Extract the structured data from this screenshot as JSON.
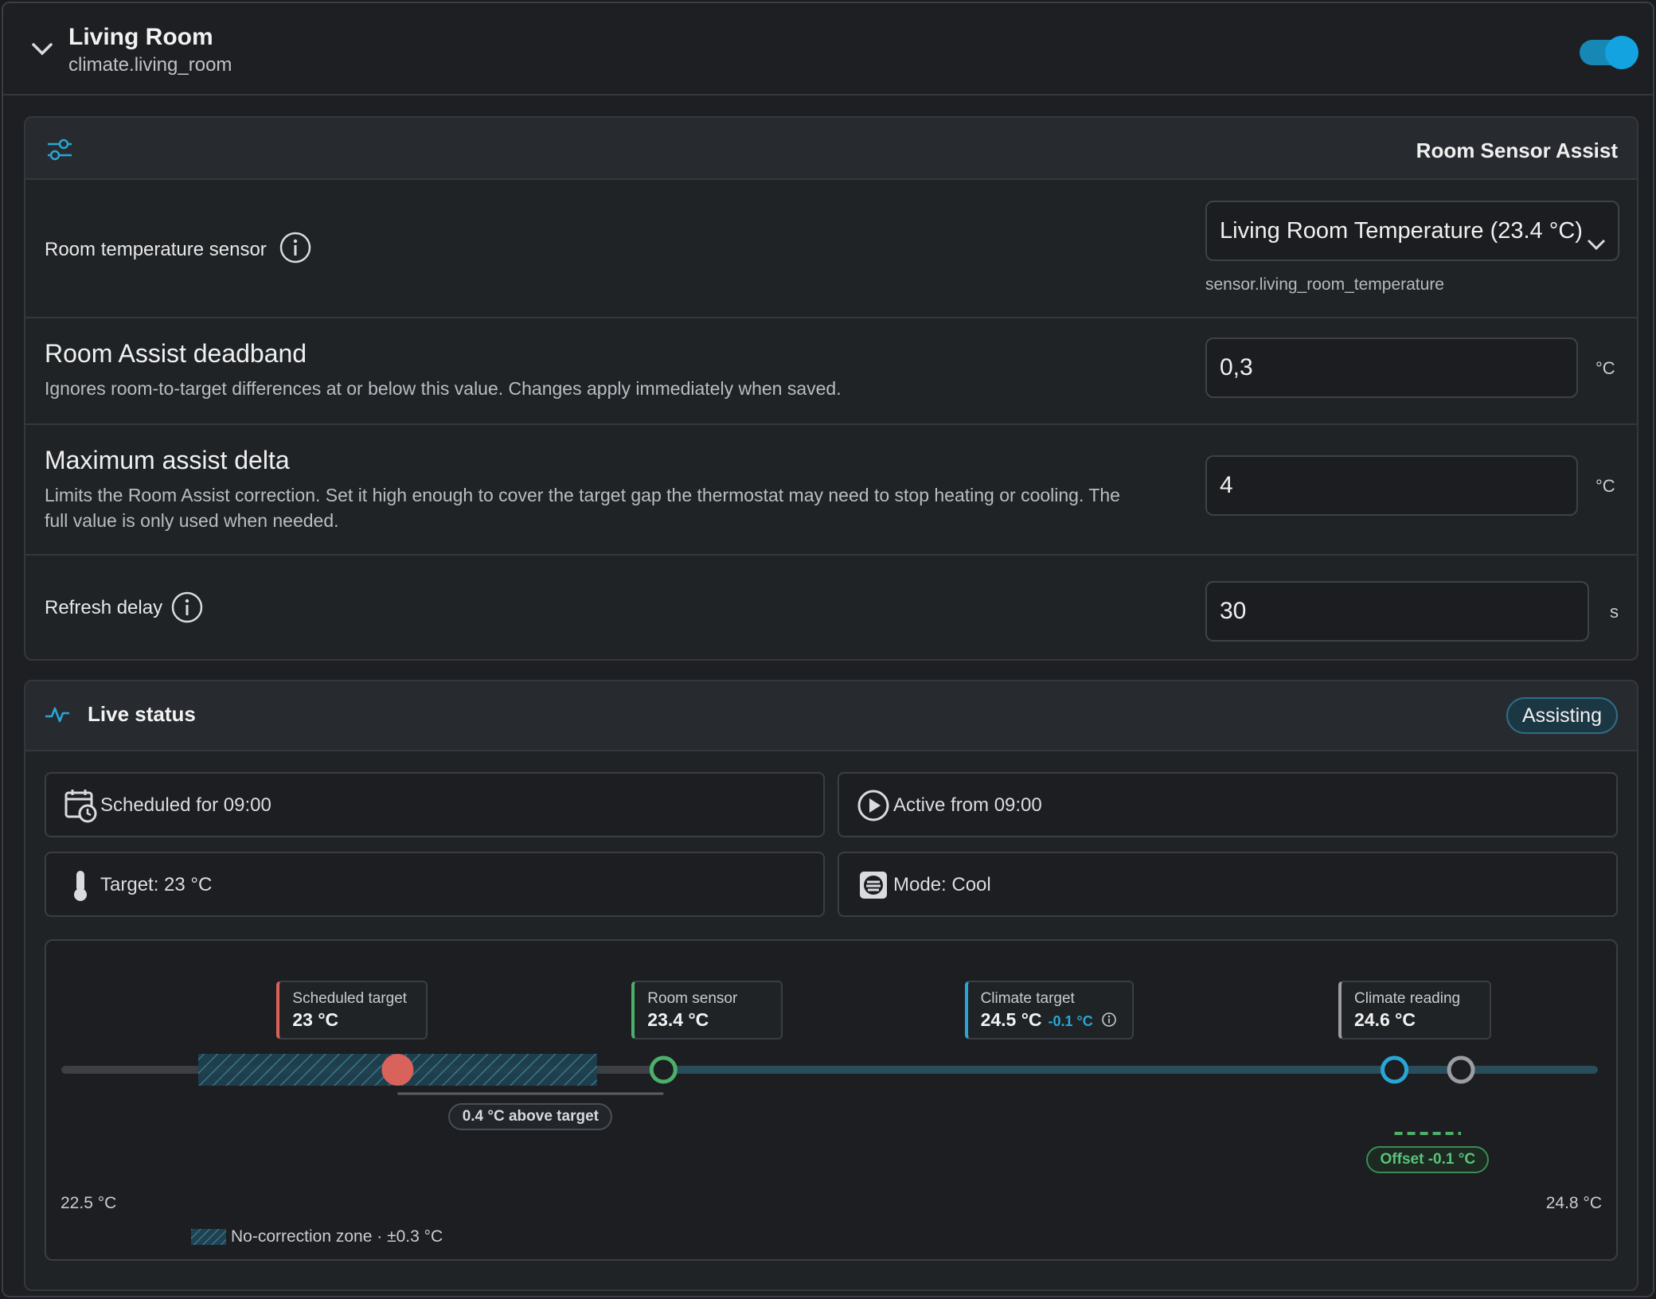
{
  "header": {
    "title": "Living Room",
    "entity_id": "climate.living_room",
    "enabled": true
  },
  "room_sensor_assist": {
    "title": "Room Sensor Assist",
    "sensor": {
      "label": "Room temperature sensor",
      "value": "Living Room Temperature (23.4 °C)",
      "helper": "sensor.living_room_temperature"
    },
    "deadband": {
      "label": "Room Assist deadband",
      "description": "Ignores room-to-target differences at or below this value. Changes apply immediately when saved.",
      "value": "0,3",
      "unit": "°C"
    },
    "max_delta": {
      "label": "Maximum assist delta",
      "description_line1": "Limits the Room Assist correction. Set it high enough to cover the target gap the thermostat may need to stop heating or cooling. The",
      "description_line2": "full value is only used when needed.",
      "value": "4",
      "unit": "°C"
    },
    "refresh": {
      "label": "Refresh delay",
      "value": "30",
      "unit": "s"
    }
  },
  "live_status": {
    "title": "Live status",
    "badge": "Assisting",
    "tiles": {
      "scheduled": "Scheduled for 09:00",
      "active": "Active from 09:00",
      "target": "Target: 23 °C",
      "mode": "Mode: Cool"
    },
    "scale": {
      "min_label": "22.5 °C",
      "max_label": "24.8 °C",
      "min": 22.5,
      "max": 24.8
    },
    "markers": {
      "scheduled_target": {
        "label": "Scheduled target",
        "value": "23 °C",
        "temp": 23.0,
        "color": "#d9625b"
      },
      "room_sensor": {
        "label": "Room sensor",
        "value": "23.4 °C",
        "temp": 23.4,
        "color": "#4caf6a"
      },
      "climate_target": {
        "label": "Climate target",
        "value": "24.5 °C",
        "offset": "-0.1 °C",
        "temp": 24.5,
        "color": "#29a6d6"
      },
      "climate_reading": {
        "label": "Climate reading",
        "value": "24.6 °C",
        "temp": 24.6,
        "color": "#9a9ea3"
      }
    },
    "deadband_zone": {
      "from": 22.7,
      "to": 23.3
    },
    "gap_label": "0.4 °C above target",
    "offset_label": "Offset -0.1 °C",
    "legend": "No-correction zone · ±0.3 °C"
  }
}
